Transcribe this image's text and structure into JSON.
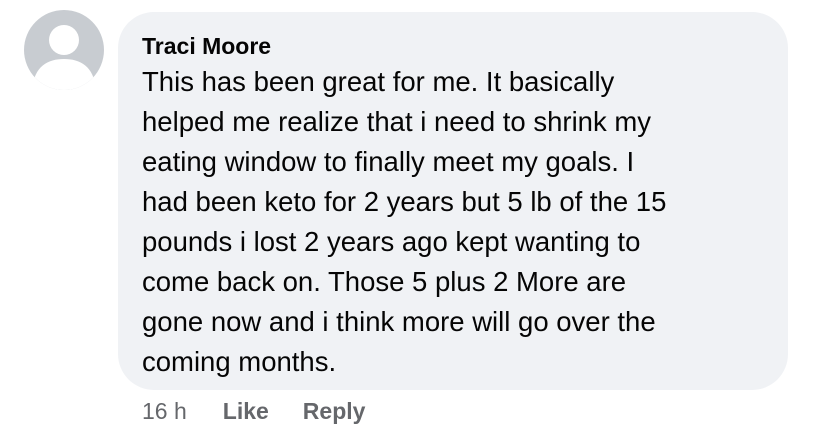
{
  "comment": {
    "author": "Traci Moore",
    "text": "This has been great for me. It basically\nhelped me realize that i need to shrink my\neating window to finally meet my goals. I\nhad been keto for 2 years but 5 lb of the 15\npounds i lost 2 years ago kept wanting to\ncome back on. Those 5 plus  2  More are\ngone now and i think more will go over the\ncoming months.",
    "timestamp": "16 h",
    "like_label": "Like",
    "reply_label": "Reply"
  },
  "avatar": {
    "icon": "default-profile-silhouette-icon",
    "background_color": "#c8ccd1",
    "silhouette_color": "#ffffff"
  },
  "colors": {
    "bubble_background": "#f0f2f5",
    "text_primary": "#050505",
    "text_secondary": "#65676b"
  }
}
